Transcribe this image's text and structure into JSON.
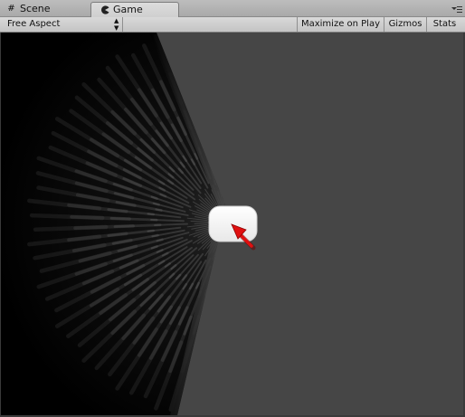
{
  "tabs": [
    {
      "label": "Scene",
      "icon": "grid-icon",
      "active": false
    },
    {
      "label": "Game",
      "icon": "game-pacman-icon",
      "active": true
    }
  ],
  "toolbar": {
    "aspect_label": "Free Aspect",
    "maximize_label": "Maximize on Play",
    "gizmos_label": "Gizmos",
    "stats_label": "Stats"
  },
  "game_view": {
    "background_color": "#464646",
    "tunnel_color": "#000000",
    "button_color": "#ffffff",
    "cursor_color": "#e01010"
  }
}
